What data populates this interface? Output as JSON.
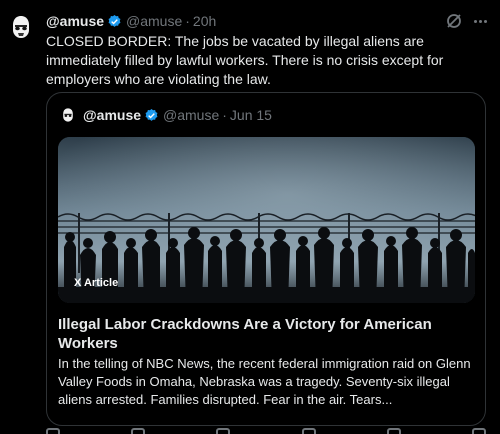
{
  "post": {
    "display_name": "@amuse",
    "handle": "@amuse",
    "separator": "·",
    "timestamp": "20h",
    "text": "CLOSED BORDER: The jobs be vacated by illegal aliens are immediately filled by lawful workers. There is no crisis except for employers who are violating the law."
  },
  "quote": {
    "display_name": "@amuse",
    "handle": "@amuse",
    "separator": "·",
    "date": "Jun 15",
    "badge": "X Article",
    "article_title": "Illegal Labor Crackdowns Are a Victory for American Workers",
    "article_excerpt": "In the telling of NBC News, the recent federal immigration raid on Glenn Valley Foods in Omaha, Nebraska was a tragedy. Seventy-six illegal aliens arrested. Families disrupted. Fear in the air. Tears..."
  },
  "colors": {
    "background": "#000000",
    "text": "#e7e9ea",
    "muted": "#71767b",
    "verified": "#1d9bf0",
    "border": "#2f3336"
  },
  "icons": [
    "stormtrooper-avatar",
    "verified-badge-icon",
    "grok-icon",
    "more-icon",
    "x-logo-icon"
  ]
}
